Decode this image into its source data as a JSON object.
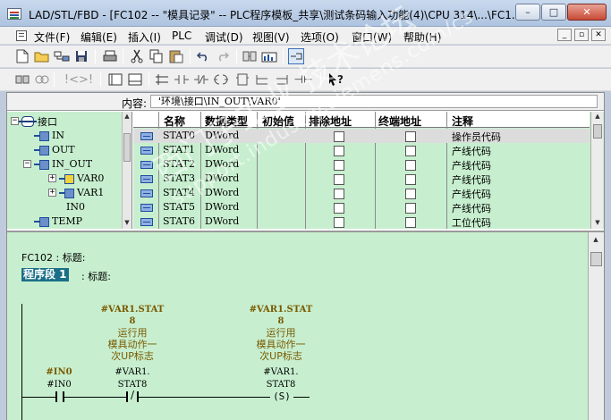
{
  "window": {
    "title": "LAD/STL/FBD  - [FC102 -- \"模具记录\" -- PLC程序模板_共享\\测试条码输入功能(4)\\CPU 314\\...\\FC1...",
    "buttons": {
      "minimize": "–",
      "maximize": "□",
      "close": "✕"
    }
  },
  "menu": {
    "items": [
      "文件(F)",
      "编辑(E)",
      "插入(I)",
      "PLC",
      "调试(D)",
      "视图(V)",
      "选项(O)",
      "窗口(W)",
      "帮助(H)"
    ],
    "mdi": {
      "minimize": "_",
      "restore": "▫",
      "close": "✕"
    }
  },
  "toolbar1": {
    "icons": [
      "new-icon",
      "open-icon",
      "accessible-nodes-icon",
      "save-icon",
      "print-icon",
      "cut-icon",
      "copy-icon",
      "paste-icon",
      "undo-icon",
      "redo-icon",
      "download-icon",
      "monitor-icon",
      "overview-icon"
    ]
  },
  "toolbar2": {
    "icons": [
      "network-icon",
      "compare-icon",
      "jump-icons",
      "ladder-icon",
      "detail-icon",
      "new-network-icon",
      "contact-no-icon",
      "contact-nc-icon",
      "coil-icon",
      "box-icon",
      "branch-open-icon",
      "branch-close-icon",
      "help-icon"
    ],
    "jump_text": "!<>!",
    "contact_text": "⊣⊢",
    "help_text": "?"
  },
  "content_bar": {
    "label": "内容:",
    "path": "'环境\\接口\\IN_OUT\\VAR0'"
  },
  "tree": {
    "items": [
      {
        "label": "接口",
        "expander": "−"
      },
      {
        "label": "IN",
        "expander": ""
      },
      {
        "label": "OUT",
        "expander": ""
      },
      {
        "label": "IN_OUT",
        "expander": "−"
      },
      {
        "label": "VAR0",
        "expander": "+"
      },
      {
        "label": "VAR1",
        "expander": "+"
      },
      {
        "label": "IN0",
        "expander": ""
      },
      {
        "label": "TEMP",
        "expander": ""
      }
    ]
  },
  "vtable": {
    "headers": [
      "名称",
      "数据类型",
      "初始值",
      "排除地址",
      "终端地址",
      "注释"
    ],
    "rows": [
      {
        "name": "STAT0",
        "type": "DWord",
        "comment": "操作员代码"
      },
      {
        "name": "STAT1",
        "type": "DWord",
        "comment": "产线代码"
      },
      {
        "name": "STAT2",
        "type": "DWord",
        "comment": "产线代码"
      },
      {
        "name": "STAT3",
        "type": "DWord",
        "comment": "产线代码"
      },
      {
        "name": "STAT4",
        "type": "DWord",
        "comment": "产线代码"
      },
      {
        "name": "STAT5",
        "type": "DWord",
        "comment": "产线代码"
      },
      {
        "name": "STAT6",
        "type": "DWord",
        "comment": "工位代码"
      }
    ]
  },
  "lad": {
    "block_title": "FC102 : 标题:",
    "segment_label": "程序段 1",
    "segment_title": ": 标题:",
    "contact1": {
      "symbol": "#IN0",
      "addr": "#IN0"
    },
    "contact2": {
      "symbol_line1": "#VAR1.STAT",
      "symbol_line2": "8",
      "comment_lines": [
        "运行用",
        "模具动作一",
        "次UP标志"
      ],
      "addr_line1": "#VAR1.",
      "addr_line2": "STAT8",
      "glyph": "/"
    },
    "coil": {
      "symbol_line1": "#VAR1.STAT",
      "symbol_line2": "8",
      "comment_lines": [
        "运行用",
        "模具动作一",
        "次UP标志"
      ],
      "addr_line1": "#VAR1.",
      "addr_line2": "STAT8",
      "glyph": "(S)"
    }
  },
  "watermark": {
    "line1": "西门子工业 技术论坛",
    "line2": "support.industry.siemens.com/cs"
  },
  "colors": {
    "editor_bg": "#c7efcf",
    "segment_bg": "#1b6f87",
    "comment": "#7a5a00"
  }
}
